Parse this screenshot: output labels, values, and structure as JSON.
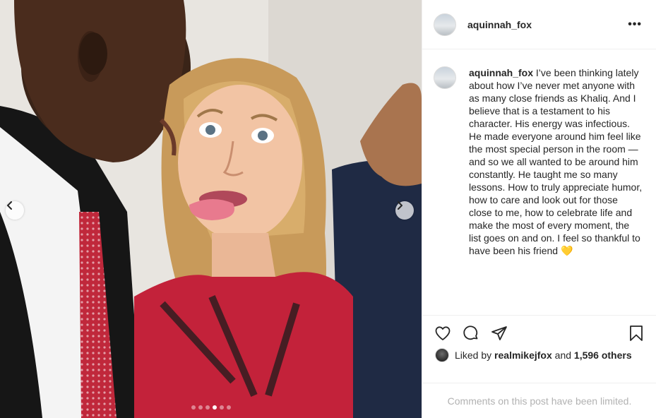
{
  "post": {
    "username": "aquinnah_fox",
    "more_icon_glyph": "•••",
    "caption_user": "aquinnah_fox",
    "caption_text": " I’ve been thinking lately about how I’ve never met anyone with as many close friends as Khaliq. And I believe that is a testament to his character. His energy was infectious. He made everyone around him feel like the most special person in the room — and so we all wanted to be around him constantly. He taught me so many lessons. How to truly appreciate humor, how to care and look out for those close to me, how to celebrate life and make the most of every moment, the list goes on and on. I feel so thankful to have been his friend 💛"
  },
  "carousel": {
    "total_slides": 6,
    "active_slide": 4,
    "prev_icon": "chevron-left-icon",
    "next_icon": "chevron-right-icon"
  },
  "actions": {
    "like_icon": "heart-icon",
    "comment_icon": "comment-icon",
    "share_icon": "share-icon",
    "save_icon": "bookmark-icon"
  },
  "likes": {
    "prefix": "Liked by ",
    "user": "realmikejfox",
    "middle": " and ",
    "count_text": "1,596 others"
  },
  "footer": {
    "comments_limited": "Comments on this post have been limited."
  },
  "colors": {
    "text": "#262626",
    "muted": "#b2b2b2",
    "divider": "#efefef",
    "heart_emoji": "#f5c542"
  }
}
